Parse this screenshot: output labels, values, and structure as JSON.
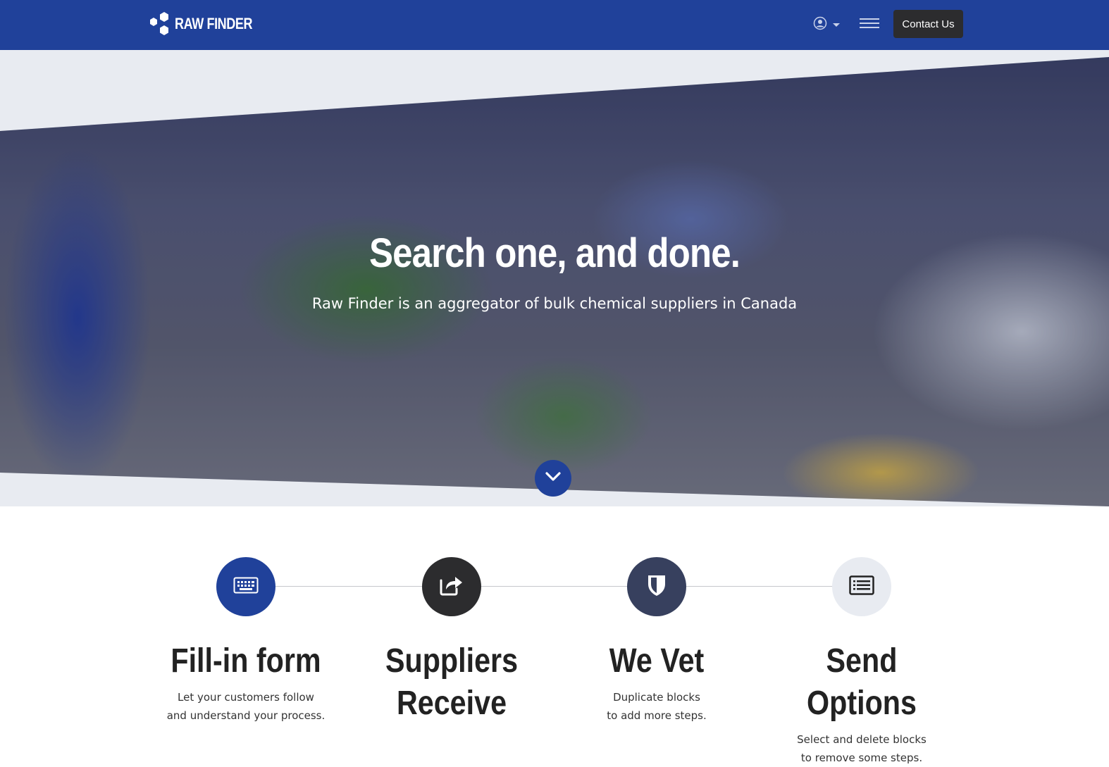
{
  "navbar": {
    "brand": "RAW FINDER",
    "contact_label": "Contact Us",
    "background": "#20419a",
    "icons": [
      "user-circle-icon",
      "caret-down-icon",
      "hamburger-menu-icon"
    ]
  },
  "hero": {
    "title": "Search one, and done.",
    "subtitle": "Raw Finder is an aggregator of bulk chemical suppliers in Canada",
    "scroll_icon": "chevron-down-icon",
    "accent": "#20419a"
  },
  "steps": [
    {
      "title": "Fill-in form",
      "desc_line1": "Let your customers follow",
      "desc_line2": "and understand your process.",
      "icon": "keyboard-icon",
      "circle_color": "#20419a"
    },
    {
      "title_line1": "Suppliers",
      "title_line2": "Receive",
      "icon": "share-icon",
      "circle_color": "#2c2c2e"
    },
    {
      "title": "We Vet",
      "desc_line1": "Duplicate blocks",
      "desc_line2": "to add more steps.",
      "icon": "shield-icon",
      "circle_color": "#37405e"
    },
    {
      "title": "Send Options",
      "desc_line1": "Select and delete blocks",
      "desc_line2": "to remove some steps.",
      "icon": "list-icon",
      "circle_color": "#e8ebf1"
    }
  ]
}
